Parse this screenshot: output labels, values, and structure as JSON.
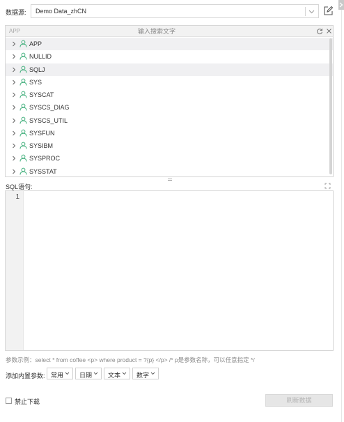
{
  "datasource": {
    "label": "数据源:",
    "value": "Demo Data_zhCN"
  },
  "tree": {
    "schema_hint": "APP",
    "search_placeholder": "输入搜索文字",
    "items": [
      {
        "label": "APP"
      },
      {
        "label": "NULLID"
      },
      {
        "label": "SQLJ"
      },
      {
        "label": "SYS"
      },
      {
        "label": "SYSCAT"
      },
      {
        "label": "SYSCS_DIAG"
      },
      {
        "label": "SYSCS_UTIL"
      },
      {
        "label": "SYSFUN"
      },
      {
        "label": "SYSIBM"
      },
      {
        "label": "SYSPROC"
      },
      {
        "label": "SYSSTAT"
      }
    ]
  },
  "sql": {
    "label": "SQL语句:",
    "line_number": "1",
    "content": ""
  },
  "param_example": "参数示例：select * from coffee <p> where product = ?{p} </p> /* p是参数名称，可以任意指定 */",
  "builtins": {
    "label": "添加内置参数:",
    "buttons": [
      {
        "label": "常用"
      },
      {
        "label": "日期"
      },
      {
        "label": "文本"
      },
      {
        "label": "数字"
      }
    ]
  },
  "disable_download": {
    "label": "禁止下载",
    "checked": false
  },
  "refresh_button": {
    "label": "刷新数据"
  },
  "colors": {
    "user_icon": "#3fae7a",
    "border": "#d7d7d7",
    "disabled_button_bg": "#e6e6e6"
  },
  "icons": {
    "edit": "edit-icon",
    "refresh": "refresh-icon",
    "clear": "close-icon",
    "expand": "expand-icon",
    "tree_arrow": "chevron-right-icon",
    "tree_node": "user-icon"
  }
}
